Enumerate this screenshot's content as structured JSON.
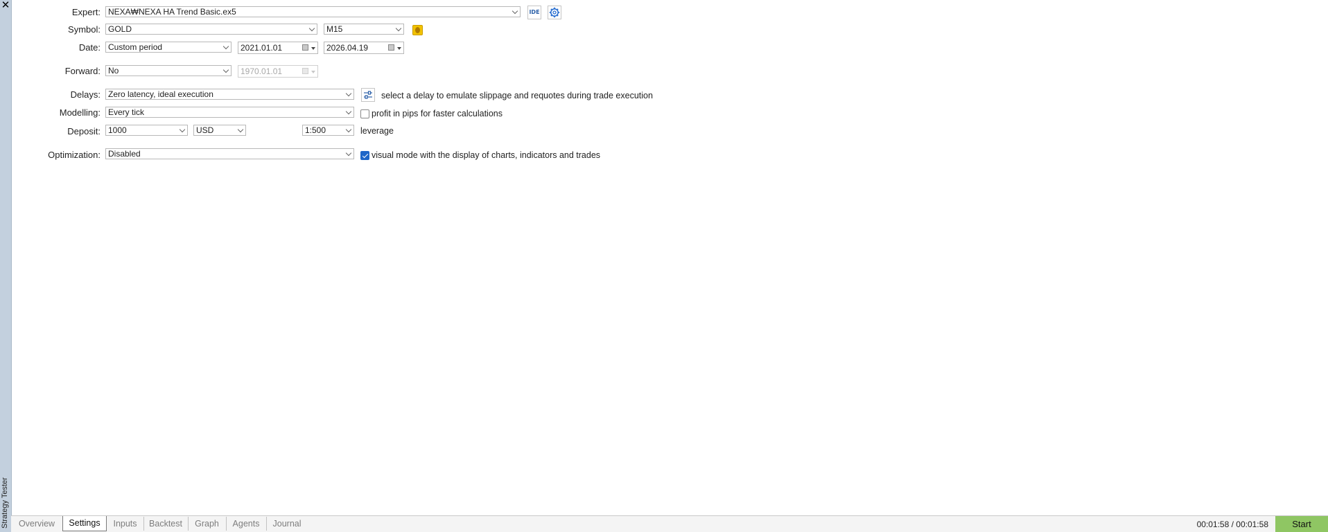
{
  "panel": {
    "vertical_title": "Strategy Tester",
    "close_glyph": "✕"
  },
  "labels": {
    "expert": "Expert:",
    "symbol": "Symbol:",
    "date": "Date:",
    "forward": "Forward:",
    "delays": "Delays:",
    "modelling": "Modelling:",
    "deposit": "Deposit:",
    "optimization": "Optimization:"
  },
  "expert": {
    "value": "NEXA₩NEXA HA Trend Basic.ex5",
    "ide_label": "IDE"
  },
  "symbol": {
    "value": "GOLD",
    "timeframe": "M15"
  },
  "date": {
    "period": "Custom period",
    "from": "2021.01.01",
    "to": "2026.04.19"
  },
  "forward": {
    "value": "No",
    "date": "1970.01.01"
  },
  "delays": {
    "value": "Zero latency, ideal execution",
    "hint": "select a delay to emulate slippage and requotes during trade execution"
  },
  "modelling": {
    "value": "Every tick",
    "pips_label": "profit in pips for faster calculations",
    "pips_checked": false
  },
  "deposit": {
    "amount": "1000",
    "currency": "USD",
    "leverage": "1:500",
    "leverage_label": "leverage"
  },
  "optimization": {
    "value": "Disabled",
    "visual_label": "visual mode with the display of charts, indicators and trades",
    "visual_checked": true
  },
  "tabs": [
    {
      "label": "Overview",
      "active": false
    },
    {
      "label": "Settings",
      "active": true
    },
    {
      "label": "Inputs",
      "active": false
    },
    {
      "label": "Backtest",
      "active": false
    },
    {
      "label": "Graph",
      "active": false
    },
    {
      "label": "Agents",
      "active": false
    },
    {
      "label": "Journal",
      "active": false
    }
  ],
  "status": {
    "timer": "00:01:58 / 00:01:58",
    "start_label": "Start"
  },
  "colors": {
    "accent": "#1e66c8",
    "start": "#8fc663",
    "sidebar": "#c3d0de",
    "coin": "#f2c200"
  }
}
